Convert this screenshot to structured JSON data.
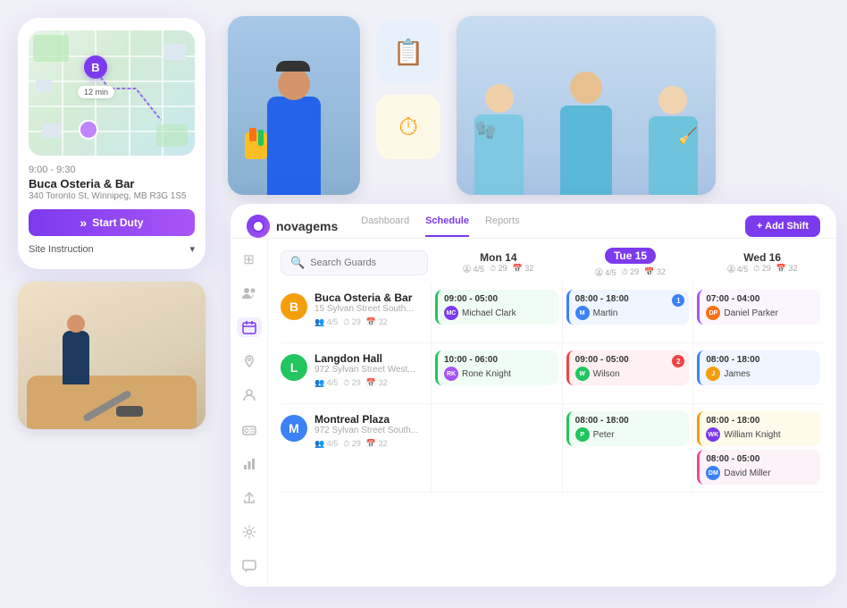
{
  "app": {
    "logo_text": "novagems",
    "nav_tabs": [
      {
        "label": "Dashboard",
        "active": false
      },
      {
        "label": "Schedule",
        "active": true
      },
      {
        "label": "Reports",
        "active": false
      }
    ],
    "add_shift_label": "+ Add Shift"
  },
  "sidebar_icons": [
    {
      "name": "grid-icon",
      "symbol": "⊞",
      "active": false
    },
    {
      "name": "users-icon",
      "symbol": "👥",
      "active": false
    },
    {
      "name": "calendar-icon",
      "symbol": "📅",
      "active": true
    },
    {
      "name": "location-icon",
      "symbol": "📍",
      "active": false
    },
    {
      "name": "person-icon",
      "symbol": "👤",
      "active": false
    },
    {
      "name": "id-card-icon",
      "symbol": "🪪",
      "active": false
    },
    {
      "name": "chart-icon",
      "symbol": "📊",
      "active": false
    },
    {
      "name": "share-icon",
      "symbol": "⬆",
      "active": false
    },
    {
      "name": "settings-icon",
      "symbol": "⚙",
      "active": false
    },
    {
      "name": "message-icon",
      "symbol": "💬",
      "active": false
    }
  ],
  "search": {
    "placeholder": "Search Guards"
  },
  "columns": [
    {
      "name": "Mon",
      "date": "Mon 14",
      "active": false,
      "stats": {
        "guards": "4/5",
        "hours": "29",
        "shifts": "32"
      }
    },
    {
      "name": "Tue",
      "date": "Tue 15",
      "active": true,
      "stats": {
        "guards": "4/5",
        "hours": "29",
        "shifts": "32"
      }
    },
    {
      "name": "Wed",
      "date": "Wed 16",
      "active": false,
      "stats": {
        "guards": "4/5",
        "hours": "29",
        "shifts": "32"
      }
    }
  ],
  "sites": [
    {
      "id": "buca",
      "name": "Buca Osteria & Bar",
      "address": "15 Sylvan Street South...",
      "avatar_letter": "B",
      "avatar_color": "#f59e0b",
      "meta": {
        "guards": "4/5",
        "hours": "29",
        "shifts": "32"
      },
      "shifts": {
        "mon": {
          "time": "09:00 - 05:00",
          "person": "Michael Clark",
          "person_initials": "MC",
          "person_color": "#7c3aed",
          "card_style": "green"
        },
        "tue": {
          "time": "08:00 - 18:00",
          "person": "Martin",
          "person_initials": "M",
          "person_color": "#3b82f6",
          "card_style": "blue",
          "badge": "1"
        },
        "wed": {
          "time": "07:00 - 04:00",
          "person": "Daniel Parker",
          "person_initials": "DP",
          "person_color": "#f97316",
          "card_style": "purple"
        }
      }
    },
    {
      "id": "langdon",
      "name": "Langdon Hall",
      "address": "972 Sylvan Street West...",
      "avatar_letter": "L",
      "avatar_color": "#22c55e",
      "meta": {
        "guards": "4/5",
        "hours": "29",
        "shifts": "32"
      },
      "shifts": {
        "mon": {
          "time": "10:00 - 06:00",
          "person": "Rone Knight",
          "person_initials": "RK",
          "person_color": "#a855f7",
          "card_style": "green"
        },
        "tue": {
          "time": "09:00 - 05:00",
          "person": "Wilson",
          "person_initials": "W",
          "person_color": "#22c55e",
          "card_style": "red",
          "badge": "2"
        },
        "wed": {
          "time": "08:00 - 18:00",
          "person": "James",
          "person_initials": "J",
          "person_color": "#f59e0b",
          "card_style": "blue"
        }
      }
    },
    {
      "id": "montreal",
      "name": "Montreal Plaza",
      "address": "972 Sylvan Street South...",
      "avatar_letter": "M",
      "avatar_color": "#3b82f6",
      "meta": {
        "guards": "4/5",
        "hours": "29",
        "shifts": "32"
      },
      "shifts": {
        "mon": null,
        "tue": {
          "time": "08:00 - 18:00",
          "person": "Peter",
          "person_initials": "P",
          "person_color": "#22c55e",
          "card_style": "green"
        },
        "wed_1": {
          "time": "08:00 - 18:00",
          "person": "William Knight",
          "person_initials": "WK",
          "person_color": "#7c3aed",
          "card_style": "yellow"
        },
        "wed_2": {
          "time": "08:00 - 05:00",
          "person": "David Miller",
          "person_initials": "DM",
          "person_color": "#3b82f6",
          "card_style": "pink"
        }
      }
    }
  ],
  "phone": {
    "time": "9:00 - 9:30",
    "location": "Buca Osteria & Bar",
    "address": "340 Toronto St, Winnipeg, MB R3G 1S5",
    "map_time": "12 min",
    "start_duty_label": "Start Duty",
    "instruction_label": "Site Instruction"
  },
  "icons": {
    "document": "📋",
    "timer": "⏱",
    "search": "🔍"
  }
}
